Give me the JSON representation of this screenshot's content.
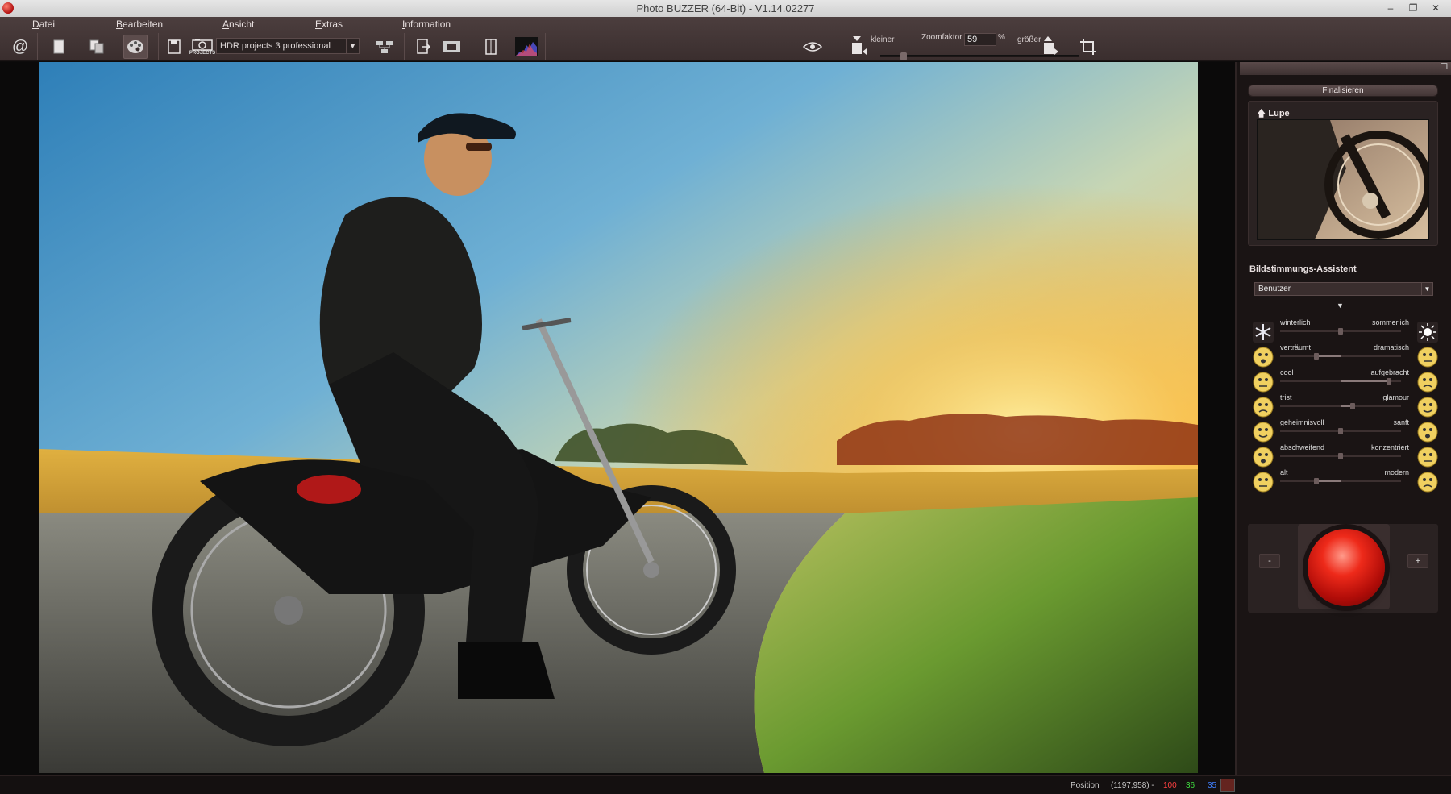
{
  "window": {
    "title": "Photo BUZZER (64-Bit) - V1.14.02277",
    "min": "–",
    "max": "❐",
    "close": "✕"
  },
  "menu": {
    "items": [
      "Datei",
      "Bearbeiten",
      "Ansicht",
      "Extras",
      "Information"
    ]
  },
  "toolbar": {
    "at_icon": "@",
    "projects_badge": "PROJECTS",
    "projects_selected": "HDR projects 3 professional",
    "zoom_smaller": "kleiner",
    "zoom_label": "Zoomfaktor",
    "zoom_value": "59",
    "zoom_unit": "%",
    "zoom_larger": "größer",
    "zoom_fraction": 0.1
  },
  "sidepanel": {
    "finalize_label": "Finalisieren",
    "lupe_title": "Lupe",
    "mood_title": "Bildstimmungs-Assistent",
    "preset_value": "Benutzer",
    "moods": [
      {
        "left": "winterlich",
        "right": "sommerlich",
        "value": 0.5,
        "icon_l": "snowflake-icon",
        "icon_r": "sun-icon"
      },
      {
        "left": "verträumt",
        "right": "dramatisch",
        "value": 0.3,
        "icon_l": "dreamy-face-icon",
        "icon_r": "dramatic-face-icon"
      },
      {
        "left": "cool",
        "right": "aufgebracht",
        "value": 0.9,
        "icon_l": "cool-face-icon",
        "icon_r": "angry-face-icon"
      },
      {
        "left": "trist",
        "right": "glamour",
        "value": 0.6,
        "icon_l": "sad-face-icon",
        "icon_r": "glamour-face-icon"
      },
      {
        "left": "geheimnisvoll",
        "right": "sanft",
        "value": 0.5,
        "icon_l": "mysterious-face-icon",
        "icon_r": "gentle-face-icon"
      },
      {
        "left": "abschweifend",
        "right": "konzentriert",
        "value": 0.5,
        "icon_l": "distracted-face-icon",
        "icon_r": "focused-face-icon"
      },
      {
        "left": "alt",
        "right": "modern",
        "value": 0.3,
        "icon_l": "old-face-icon",
        "icon_r": "modern-face-icon"
      }
    ],
    "minus_label": "-",
    "plus_label": "+"
  },
  "status": {
    "position_label": "Position",
    "position_value": "(1197,958) -",
    "r": "100",
    "g": "36",
    "b": "35",
    "swatch_color": "#64241f"
  }
}
